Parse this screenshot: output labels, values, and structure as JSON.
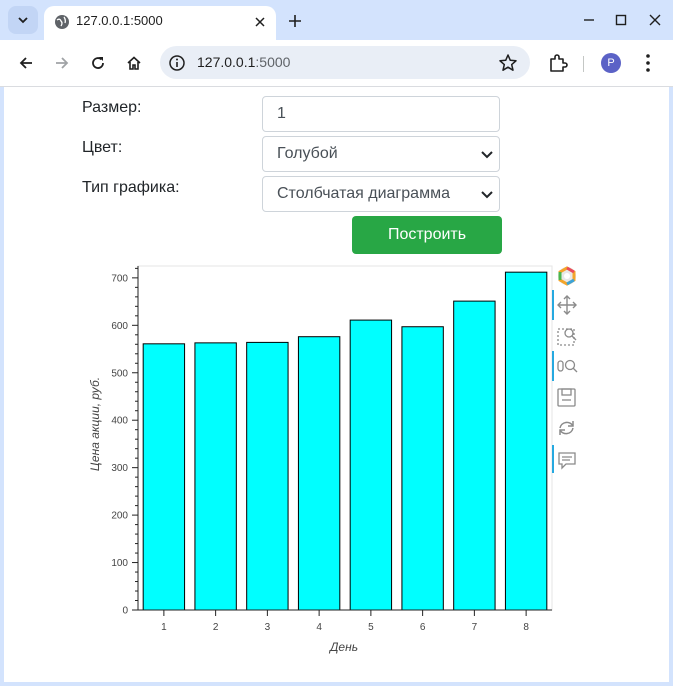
{
  "browser": {
    "tab_title": "127.0.0.1:5000",
    "url_host": "127.0.0.1",
    "url_port": ":5000",
    "profile_initial": "P"
  },
  "form": {
    "size_label": "Размер:",
    "size_value": "1",
    "color_label": "Цвет:",
    "color_value": "Голубой",
    "chart_type_label": "Тип графика:",
    "chart_type_value": "Столбчатая диаграмма",
    "submit_label": "Построить"
  },
  "chart_data": {
    "type": "bar",
    "categories": [
      "1",
      "2",
      "3",
      "4",
      "5",
      "6",
      "7",
      "8"
    ],
    "values": [
      561,
      563,
      564,
      576,
      611,
      597,
      651,
      712
    ],
    "xlabel": "День",
    "ylabel": "Цена акции, руб.",
    "ylim": [
      0,
      725
    ],
    "yticks": [
      0,
      100,
      200,
      300,
      400,
      500,
      600,
      700
    ],
    "bar_color": "#00ffff",
    "bar_edge_color": "#000000",
    "grid": false
  },
  "chart_toolbar": {
    "tools": [
      "bokeh-logo-icon",
      "pan-icon",
      "box-zoom-icon",
      "wheel-zoom-icon",
      "save-icon",
      "reset-icon",
      "hover-icon"
    ]
  }
}
